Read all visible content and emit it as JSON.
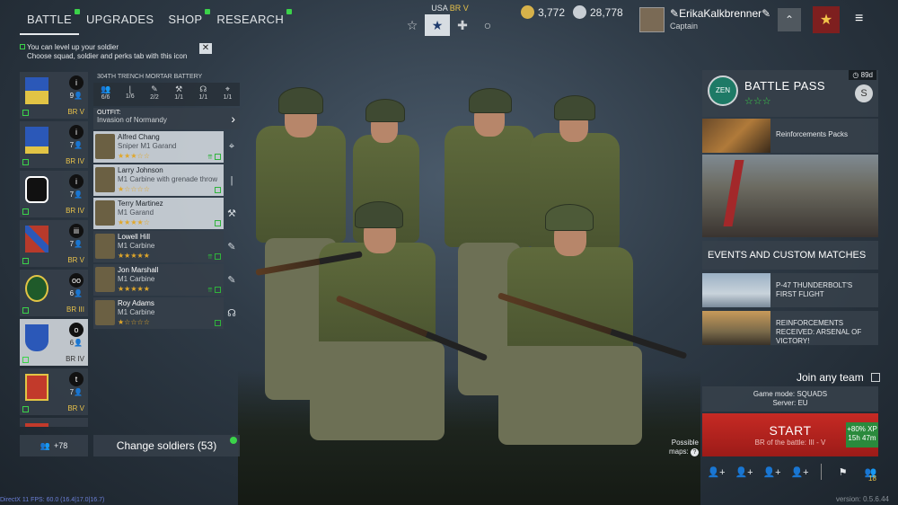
{
  "tabs": [
    {
      "label": "BATTLE",
      "active": true,
      "notify": true
    },
    {
      "label": "UPGRADES",
      "active": false,
      "notify": false
    },
    {
      "label": "SHOP",
      "active": false,
      "notify": true
    },
    {
      "label": "RESEARCH",
      "active": false,
      "notify": true
    }
  ],
  "nation": {
    "country": "USA",
    "br": "BR V"
  },
  "currency": {
    "silver": "3,772",
    "gold": "28,778"
  },
  "player": {
    "name": "ErikaKalkbrenner",
    "rank": "Captain"
  },
  "hint": {
    "line1": "You can level up your soldier",
    "line2": "Choose squad, soldier and perks tab with this icon"
  },
  "squads": [
    {
      "count": "9",
      "br": "BR V",
      "selected": false,
      "cls": "i"
    },
    {
      "count": "7",
      "br": "BR IV",
      "selected": false,
      "cls": "i"
    },
    {
      "count": "7",
      "br": "BR IV",
      "selected": false,
      "cls": "i"
    },
    {
      "count": "7",
      "br": "BR V",
      "selected": false,
      "cls": "iii"
    },
    {
      "count": "6",
      "br": "BR III",
      "selected": false,
      "cls": "oo"
    },
    {
      "count": "6",
      "br": "BR IV",
      "selected": true,
      "cls": "o"
    },
    {
      "count": "7",
      "br": "BR V",
      "selected": false,
      "cls": "t"
    }
  ],
  "unit": {
    "name": "304TH TRENCH MORTAR BATTERY",
    "stats": [
      "6/6",
      "1/6",
      "2/2",
      "1/1",
      "1/1",
      "1/1"
    ],
    "outfit_label": "OUTFIT:",
    "outfit_value": "Invasion of Normandy"
  },
  "soldiers": [
    {
      "name": "Alfred Chang",
      "weapon": "Sniper M1 Garand",
      "stars": "★★★☆☆",
      "icon": "⌖",
      "selected": true
    },
    {
      "name": "Larry Johnson",
      "weapon": "M1 Carbine with grenade throw",
      "stars": "★☆☆☆☆",
      "icon": "|",
      "selected": true
    },
    {
      "name": "Terry Martinez",
      "weapon": "M1 Garand",
      "stars": "★★★★☆",
      "icon": "⚒",
      "selected": true
    },
    {
      "name": "Lowell Hill",
      "weapon": "M1 Carbine",
      "stars": "★★★★★",
      "icon": "✎",
      "selected": false
    },
    {
      "name": "Jon Marshall",
      "weapon": "M1 Carbine",
      "stars": "★★★★★",
      "icon": "✎",
      "selected": false
    },
    {
      "name": "Roy Adams",
      "weapon": "M1 Carbine",
      "stars": "★☆☆☆☆",
      "icon": "☊",
      "selected": false
    }
  ],
  "bottom_left": {
    "squad_count": "+78",
    "change_label": "Change soldiers (53)"
  },
  "battle_pass": {
    "title": "BATTLE PASS",
    "stars": "☆☆☆",
    "days": "89d",
    "logo": "ZEN",
    "s": "S"
  },
  "reinforcements": {
    "label": "Reinforcements Packs"
  },
  "events": {
    "title": "EVENTS AND CUSTOM MATCHES",
    "items": [
      {
        "label": "P-47 THUNDERBOLT'S FIRST FLIGHT"
      },
      {
        "label": "REINFORCEMENTS RECEIVED: ARSENAL OF VICTORY!"
      }
    ]
  },
  "join": {
    "label": "Join any team"
  },
  "game": {
    "mode": "Game mode: SQUADS",
    "server": "Server: EU"
  },
  "start": {
    "label": "START",
    "br": "BR of the battle: III - V",
    "xp": "+80% XP",
    "time": "15h 47m"
  },
  "maps": {
    "label": "Possible maps:"
  },
  "group_count": "18",
  "debug": "DirectX 11 FPS: 60.0 (16.4|17.0|16.7)",
  "version": "version: 0.5.6.44",
  "colors": {
    "accent_green": "#3bd34a",
    "start_red": "#c62a24",
    "br_gold": "#e8c24a"
  }
}
